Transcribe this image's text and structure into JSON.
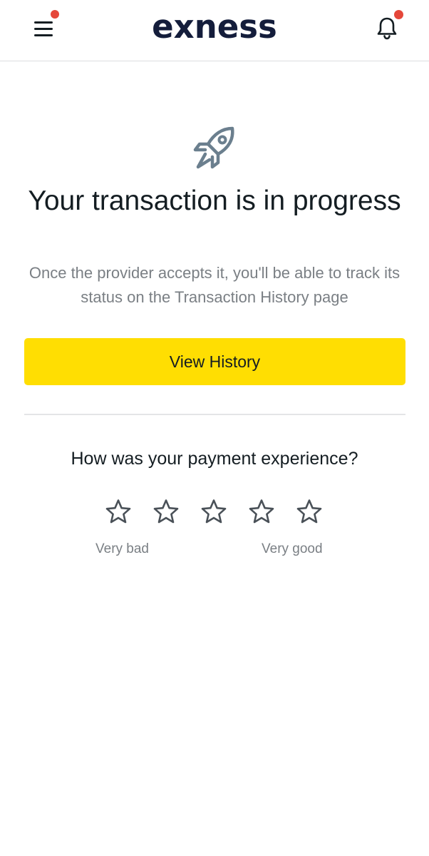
{
  "header": {
    "logo_text": "exness",
    "menu_icon": "hamburger-menu-icon",
    "notification_icon": "bell-icon",
    "badge_color": "#e5473a"
  },
  "status": {
    "icon": "rocket-icon",
    "title": "Your transaction is in progress",
    "description": "Once the provider accepts it, you'll be able to track its status on the Transaction History page"
  },
  "actions": {
    "view_history_label": "View History",
    "button_color": "#ffde02"
  },
  "feedback": {
    "question": "How was your payment experience?",
    "rating_max": 5,
    "rating_value": 0,
    "low_label": "Very bad",
    "high_label": "Very good"
  }
}
